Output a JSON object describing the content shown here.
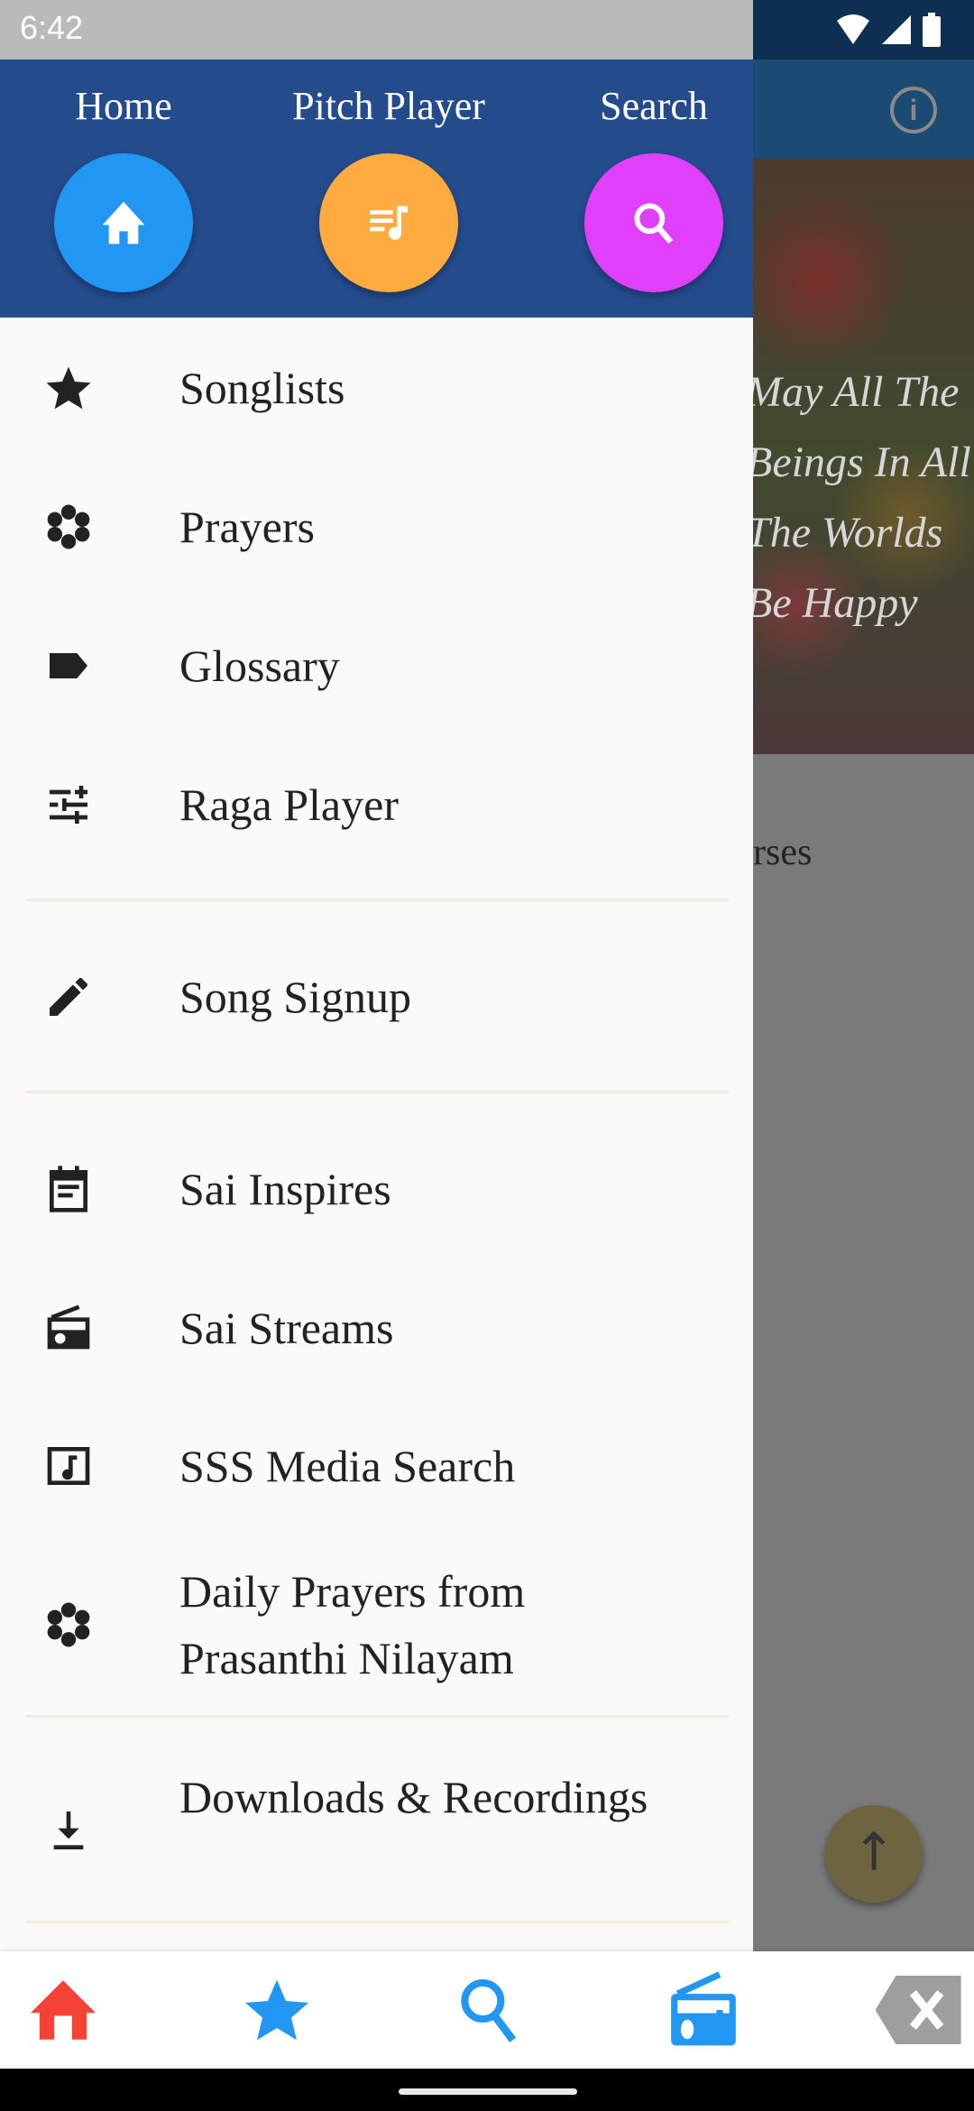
{
  "status_bar": {
    "time": "6:42",
    "icons": [
      "wifi-icon",
      "signal-icon",
      "battery-icon"
    ]
  },
  "background": {
    "banner_text": "May All The\nBeings In All\nThe Worlds\nBe Happy",
    "partial_text": "rses",
    "fab_icon": "arrow-up-icon"
  },
  "drawer": {
    "header_buttons": [
      {
        "label": "Home",
        "icon": "home-icon",
        "color": "#2196f3"
      },
      {
        "label": "Pitch Player",
        "icon": "queue-music-icon",
        "color": "#ffab40"
      },
      {
        "label": "Search",
        "icon": "search-icon",
        "color": "#e040fb"
      }
    ],
    "items": [
      {
        "label": "Songlists",
        "icon": "star-icon"
      },
      {
        "label": "Prayers",
        "icon": "flower-icon"
      },
      {
        "label": "Glossary",
        "icon": "label-icon"
      },
      {
        "label": "Raga Player",
        "icon": "tune-icon"
      },
      {
        "label": "Song Signup",
        "icon": "pencil-icon"
      },
      {
        "label": "Sai Inspires",
        "icon": "event-note-icon"
      },
      {
        "label": "Sai Streams",
        "icon": "radio-icon"
      },
      {
        "label": "SSS Media Search",
        "icon": "music-box-icon"
      },
      {
        "label": "Daily Prayers from Prasanthi Nilayam",
        "icon": "flower-icon"
      },
      {
        "label": "Downloads & Recordings",
        "icon": "download-icon"
      }
    ]
  },
  "bottom_nav": [
    {
      "icon": "home-icon",
      "color": "#f44336"
    },
    {
      "icon": "star-icon",
      "color": "#2196f3"
    },
    {
      "icon": "search-icon",
      "color": "#2196f3"
    },
    {
      "icon": "radio-icon",
      "color": "#2196f3"
    },
    {
      "icon": "backspace-icon",
      "color": "#9e9e9e"
    }
  ]
}
